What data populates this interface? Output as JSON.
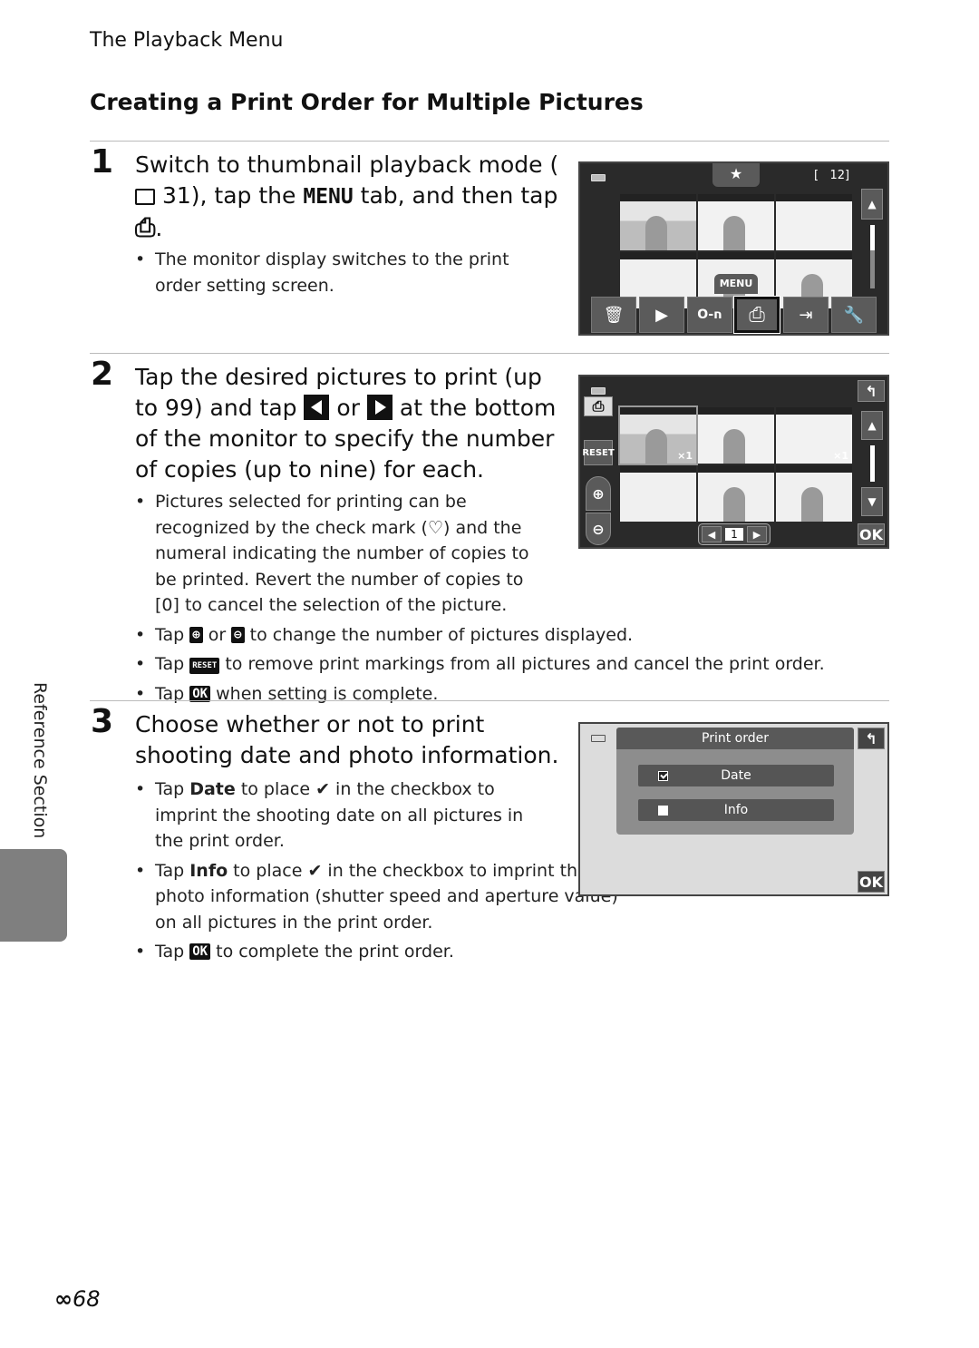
{
  "page": {
    "running_head": "The Playback Menu",
    "section_title": "Creating a Print Order for Multiple Pictures",
    "side_label": "Reference Section",
    "page_number": "68",
    "page_prefix_icon": "binoculars-icon"
  },
  "steps": [
    {
      "number": "1",
      "heading_parts": [
        "Switch to thumbnail playback mode (",
        " 31), tap the ",
        " tab, and then tap ",
        "."
      ],
      "menu_tab_label": "MENU",
      "book_icon": "book-icon",
      "print_icon": "print-order-icon",
      "bullets": [
        "The monitor display switches to the print order setting screen."
      ]
    },
    {
      "number": "2",
      "heading_parts": [
        "Tap the desired pictures to print (up to 99) and tap ",
        " or ",
        " at the bottom of the monitor to specify the number of copies (up to nine) for each."
      ],
      "bullets": [
        {
          "before": "Pictures selected for printing can be recognized by the check mark (",
          "icon": "check-mark-icon",
          "after": ") and the numeral indicating the number of copies to be printed. Revert the number of copies to [0] to cancel the selection of the picture."
        },
        {
          "before": "Tap ",
          "icon1": "zoom-in-icon",
          "mid": " or ",
          "icon2": "zoom-out-icon",
          "after": " to change the number of pictures displayed."
        },
        {
          "before": "Tap ",
          "icon": "RESET",
          "after": " to remove print markings from all pictures and cancel the print order."
        },
        {
          "before": "Tap ",
          "icon": "OK",
          "after": " when setting is complete."
        }
      ]
    },
    {
      "number": "3",
      "heading": "Choose whether or not to print shooting date and photo information.",
      "bullets": [
        {
          "before": "Tap ",
          "bold": "Date",
          "after1": " to place ",
          "icon": "✔",
          "after2": " in the checkbox to imprint the shooting date on all pictures in the print order."
        },
        {
          "before": "Tap ",
          "bold": "Info",
          "after1": " to place ",
          "icon": "✔",
          "after2": " in the checkbox to imprint the photo information (shutter speed and aperture value) on all pictures in the print order."
        },
        {
          "before": "Tap ",
          "icon": "OK",
          "after": " to complete the print order."
        }
      ]
    }
  ],
  "screen1": {
    "tab_icon": "★",
    "counter": "[   12]",
    "menu_label": "MENU",
    "toolbar": [
      "delete-icon",
      "slideshow-icon",
      "protect-icon",
      "print-order-icon",
      "copy-icon",
      "setup-icon"
    ],
    "toolbar_glyphs": [
      "🗑",
      "▶",
      "O-π",
      "⎙",
      "⇥",
      "🔧"
    ]
  },
  "screen2": {
    "reset_label": "RESET",
    "copies_value": "1",
    "ok_label": "OK",
    "copy_badges": [
      "×1",
      "×1"
    ]
  },
  "screen3": {
    "title": "Print order",
    "options": [
      {
        "label": "Date",
        "checked": true
      },
      {
        "label": "Info",
        "checked": false
      }
    ],
    "ok_label": "OK"
  }
}
